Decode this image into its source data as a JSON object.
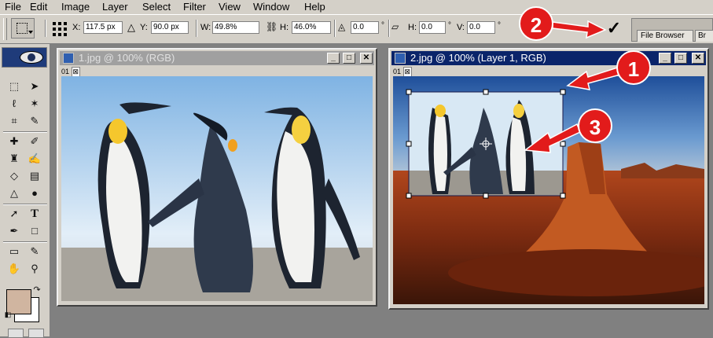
{
  "menubar": {
    "items": [
      "File",
      "Edit",
      "Image",
      "Layer",
      "Select",
      "Filter",
      "View",
      "Window",
      "Help"
    ]
  },
  "options": {
    "x_label": "X:",
    "x_value": "117.5 px",
    "y_label": "Y:",
    "y_value": "90.0 px",
    "w_label": "W:",
    "w_value": "49.8%",
    "h_label": "H:",
    "h_value": "46.0%",
    "rotate_value": "0.0",
    "hskew_label": "H:",
    "hskew_value": "0.0",
    "vskew_label": "V:",
    "vskew_value": "0.0",
    "degree_symbol": "°",
    "commit_symbol": "✓",
    "palette_tabs": [
      "File Browser",
      "Br"
    ]
  },
  "toolbox": {
    "tools": [
      "rect-marquee",
      "move",
      "lasso",
      "magic-wand",
      "crop",
      "slice",
      "healing-brush",
      "brush",
      "clone-stamp",
      "history-brush",
      "eraser",
      "gradient",
      "blur",
      "dodge",
      "path-select",
      "type",
      "pen",
      "shape",
      "notes",
      "eyedropper",
      "hand",
      "zoom"
    ],
    "foreground_color": "#d0b5a0",
    "background_color": "#ffffff"
  },
  "doc1": {
    "title": "1.jpg @ 100% (RGB)",
    "label": "01",
    "state": "inactive"
  },
  "doc2": {
    "title": "2.jpg @ 100% (Layer 1, RGB)",
    "label": "01",
    "state": "active"
  },
  "callouts": [
    "1",
    "2",
    "3"
  ],
  "colors": {
    "callout_red": "#e21b1b",
    "active_title": "#0a246a",
    "inactive_title": "#a0a0a0",
    "chrome": "#d4d0c8"
  }
}
